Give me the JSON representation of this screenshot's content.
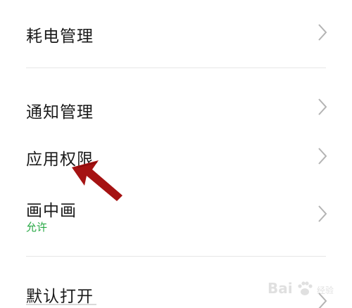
{
  "settings": {
    "items": [
      {
        "title": "耗电管理",
        "icon": "chevron-right-icon"
      },
      {
        "title": "通知管理",
        "icon": "chevron-right-icon"
      },
      {
        "title": "应用权限",
        "icon": "chevron-right-icon"
      },
      {
        "title": "画中画",
        "subtitle": "允许",
        "icon": "chevron-right-icon"
      },
      {
        "title": "默认打开",
        "icon": "chevron-right-icon"
      }
    ]
  },
  "annotation": {
    "icon": "red-arrow-icon",
    "color": "#a51212"
  },
  "watermark": {
    "brand": "Bai",
    "sub": "经验"
  },
  "colors": {
    "accent_green": "#27a844",
    "text": "#1a1a1a",
    "chevron": "#b3b3b3"
  }
}
